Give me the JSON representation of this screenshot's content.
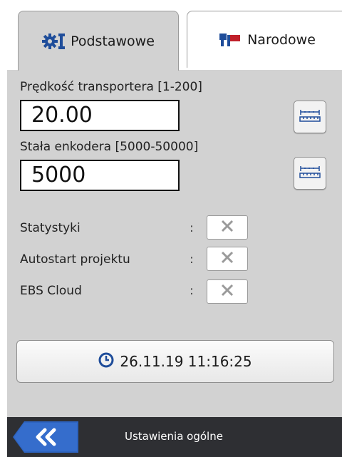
{
  "tabs": [
    {
      "label": "Podstawowe",
      "icon": "gears-icon",
      "active": true
    },
    {
      "label": "Narodowe",
      "icon": "flag-icon",
      "active": false
    }
  ],
  "fields": [
    {
      "label": "Prędkość transportera [1-200]",
      "value": "20.00",
      "button_icon": "ruler-icon"
    },
    {
      "label": "Stała enkodera [5000-50000]",
      "value": "5000",
      "button_icon": "ruler-icon"
    }
  ],
  "options": [
    {
      "label": "Statystyki",
      "separator": ":",
      "checked": false
    },
    {
      "label": "Autostart projektu",
      "separator": ":",
      "checked": false
    },
    {
      "label": "EBS Cloud",
      "separator": ":",
      "checked": false
    }
  ],
  "datetime": {
    "value": "26.11.19 11:16:25",
    "icon": "clock-icon"
  },
  "footer": {
    "title": "Ustawienia ogólne",
    "back_icon": "double-chevron-left-icon"
  },
  "colors": {
    "accent": "#2d5eb0",
    "panel": "#d2d2d2",
    "footer": "#2e2f33",
    "check_x": "#9a9a9a"
  }
}
